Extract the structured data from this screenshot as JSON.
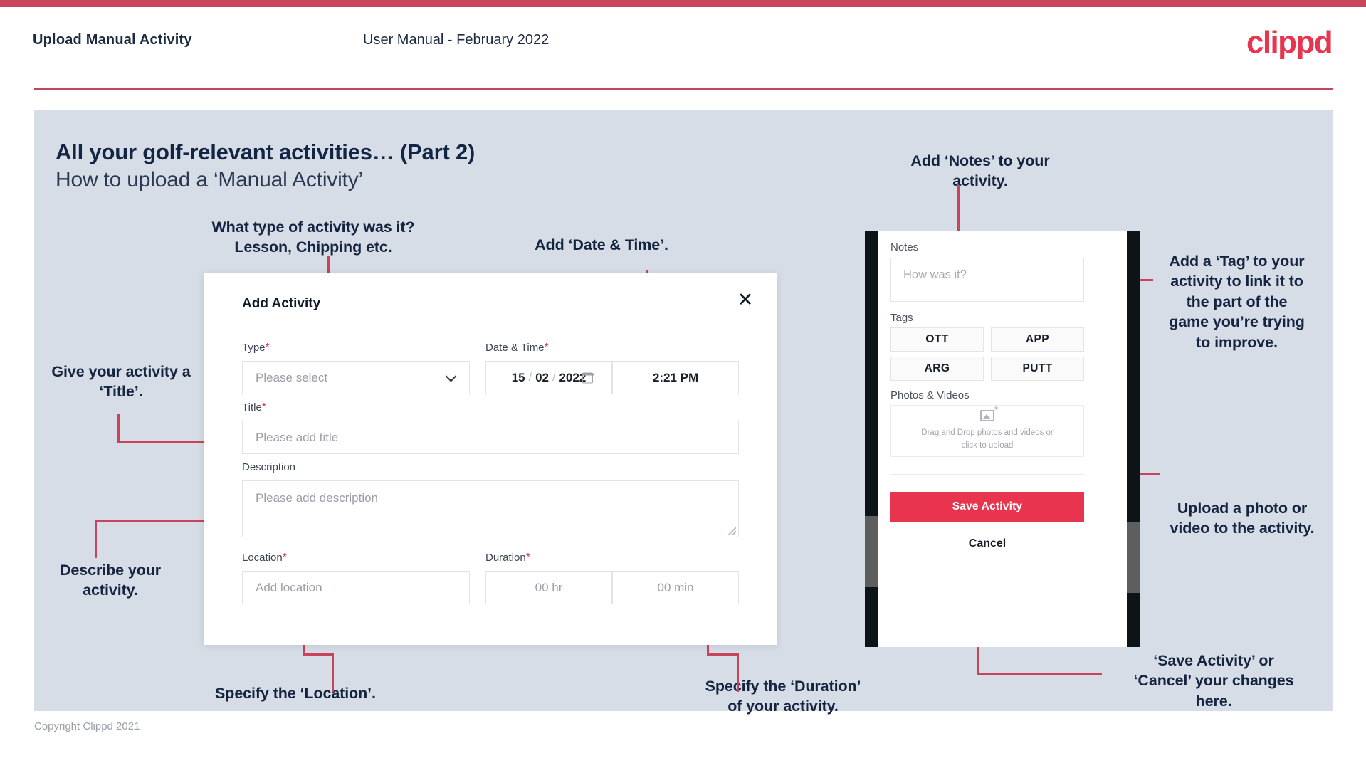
{
  "header": {
    "title": "Upload Manual Activity",
    "subtitle": "User Manual - February 2022",
    "logo": "clippd",
    "brand_color": "#e8344e",
    "rule_color": "#c2455f"
  },
  "slide": {
    "heading": "All your golf-relevant activities… (Part 2)",
    "subheading": "How to upload a ‘Manual Activity’",
    "background": "#d7dde6"
  },
  "annotations": {
    "type": "What type of activity was it?\nLesson, Chipping etc.",
    "datetime": "Add ‘Date & Time’.",
    "title": "Give your activity a\n‘Title’.",
    "describe": "Describe your\nactivity.",
    "location": "Specify the ‘Location’.",
    "duration": "Specify the ‘Duration’\nof your activity.",
    "notes": "Add ‘Notes’ to your\nactivity.",
    "tags": "Add a ‘Tag’ to your\nactivity to link it to\nthe part of the\ngame you’re trying\nto improve.",
    "photos": "Upload a photo or\nvideo to the activity.",
    "save": "‘Save Activity’ or\n‘Cancel’ your changes\nhere."
  },
  "dialog": {
    "title": "Add Activity",
    "close_icon": "close-icon",
    "fields": {
      "type": {
        "label": "Type",
        "required": "*",
        "value": "",
        "placeholder": "Please select",
        "chevron_icon": "chevron-down-icon"
      },
      "datetime": {
        "label": "Date & Time",
        "required": "*",
        "day": "15",
        "month": "02",
        "year": "2022",
        "separator": "/",
        "time": "2:21 PM",
        "calendar_icon": "calendar-icon"
      },
      "title": {
        "label": "Title",
        "required": "*",
        "value": "",
        "placeholder": "Please add title"
      },
      "description": {
        "label": "Description",
        "required": "",
        "value": "",
        "placeholder": "Please add description"
      },
      "location": {
        "label": "Location",
        "required": "*",
        "value": "",
        "placeholder": "Add location"
      },
      "duration": {
        "label": "Duration",
        "required": "*",
        "hours_placeholder": "00 hr",
        "minutes_placeholder": "00 min"
      }
    }
  },
  "phone": {
    "notes": {
      "label": "Notes",
      "value": "",
      "placeholder": "How was it?"
    },
    "tags": {
      "label": "Tags",
      "options": [
        "OTT",
        "APP",
        "ARG",
        "PUTT"
      ]
    },
    "photos": {
      "label": "Photos & Videos",
      "icon": "add-image-icon",
      "drop_text_line1": "Drag and Drop photos and videos or",
      "drop_text_line2": "click to upload"
    },
    "save_label": "Save Activity",
    "cancel_label": "Cancel",
    "save_color": "#e8344e"
  },
  "footer": {
    "copyright": "Copyright Clippd 2021"
  }
}
